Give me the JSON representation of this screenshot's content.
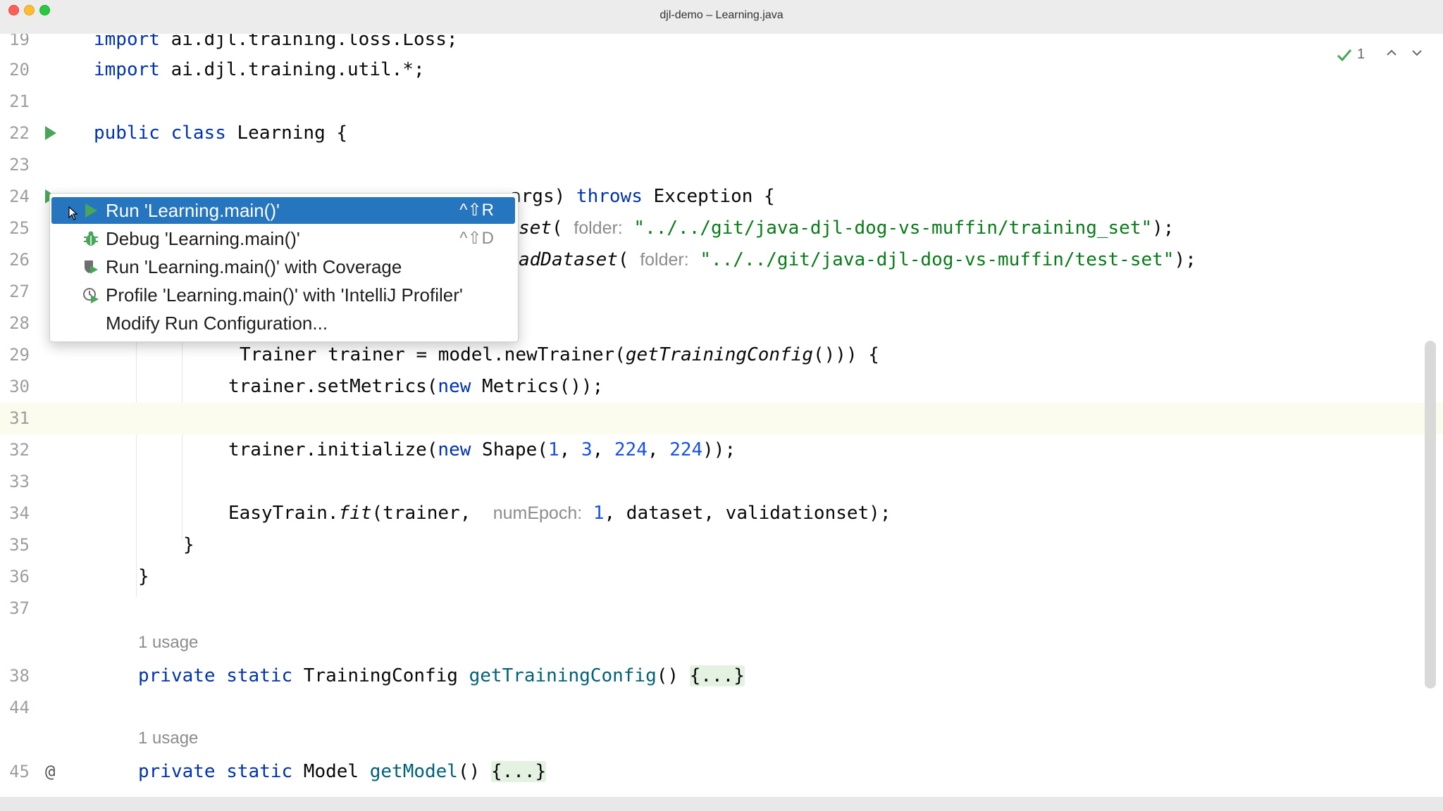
{
  "window": {
    "title": "djl-demo – Learning.java"
  },
  "inspection": {
    "count": "1"
  },
  "colors": {
    "keyword": "#0033b3",
    "string": "#067d17",
    "number": "#1750eb",
    "method": "#00627a",
    "selection": "#2675bf",
    "run_green": "#4aa55a"
  },
  "editor": {
    "lines": {
      "l19": {
        "num": "19",
        "text": "import ai.djl.training.loss.Loss;"
      },
      "l20": {
        "num": "20",
        "kw": "import",
        "text": " ai.djl.training.util.*;"
      },
      "l21": {
        "num": "21"
      },
      "l22": {
        "num": "22",
        "kw1": "public",
        "kw2": "class",
        "text": " Learning {"
      },
      "l23": {
        "num": "23"
      },
      "l24": {
        "num": "24",
        "text_a": "args) ",
        "kw": "throws",
        "text_b": " Exception {"
      },
      "l25": {
        "num": "25",
        "fn": "set",
        "paren": "(",
        "hint": "folder:",
        "str": "\"../../git/java-djl-dog-vs-muffin/training_set\"",
        "end": ");"
      },
      "l26": {
        "num": "26",
        "fn": "adDataset",
        "paren": "(",
        "hint": "folder:",
        "str": "\"../../git/java-djl-dog-vs-muffin/test-set\"",
        "end": ");"
      },
      "l27": {
        "num": "27"
      },
      "l28": {
        "num": "28"
      },
      "l29": {
        "num": "29",
        "text_a": "Trainer trainer = model.newTrainer(",
        "it": "getTrainingConfig",
        "text_b": "())) {"
      },
      "l30": {
        "num": "30",
        "text_a": "trainer.setMetrics(",
        "kw": "new",
        "text_b": " Metrics());"
      },
      "l31": {
        "num": "31"
      },
      "l32": {
        "num": "32",
        "text_a": "trainer.initialize(",
        "kw": "new",
        "text_b": " Shape(",
        "n1": "1",
        "c1": ", ",
        "n2": "3",
        "c2": ", ",
        "n3": "224",
        "c3": ", ",
        "n4": "224",
        "text_c": "));"
      },
      "l33": {
        "num": "33"
      },
      "l34": {
        "num": "34",
        "text_a": "EasyTrain.",
        "it": "fit",
        "text_b": "(trainer, ",
        "hint": "numEpoch:",
        "n": "1",
        "text_c": ", dataset, validationset);"
      },
      "l35": {
        "num": "35",
        "text": "}"
      },
      "l36": {
        "num": "36",
        "text": "}"
      },
      "l37": {
        "num": "37"
      },
      "u38": {
        "text": "1 usage"
      },
      "l38": {
        "num": "38",
        "kw1": "private",
        "kw2": "static",
        "type": " TrainingConfig ",
        "fn": "getTrainingConfig",
        "paren": "() ",
        "fold": "{...}"
      },
      "l44": {
        "num": "44"
      },
      "u45": {
        "text": "1 usage"
      },
      "l45": {
        "num": "45",
        "marker": "@",
        "kw1": "private",
        "kw2": "static",
        "type": " Model ",
        "fn": "getModel",
        "paren": "() ",
        "fold": "{...}"
      }
    }
  },
  "run_popup": {
    "items": [
      {
        "label": "Run 'Learning.main()'",
        "shortcut": "^⇧R",
        "icon": "run-icon"
      },
      {
        "label": "Debug 'Learning.main()'",
        "shortcut": "^⇧D",
        "icon": "debug-bug-icon"
      },
      {
        "label": "Run 'Learning.main()' with Coverage",
        "icon": "coverage-shield-icon"
      },
      {
        "label": "Profile 'Learning.main()' with 'IntelliJ Profiler'",
        "icon": "profiler-icon"
      },
      {
        "label": "Modify Run Configuration..."
      }
    ]
  }
}
